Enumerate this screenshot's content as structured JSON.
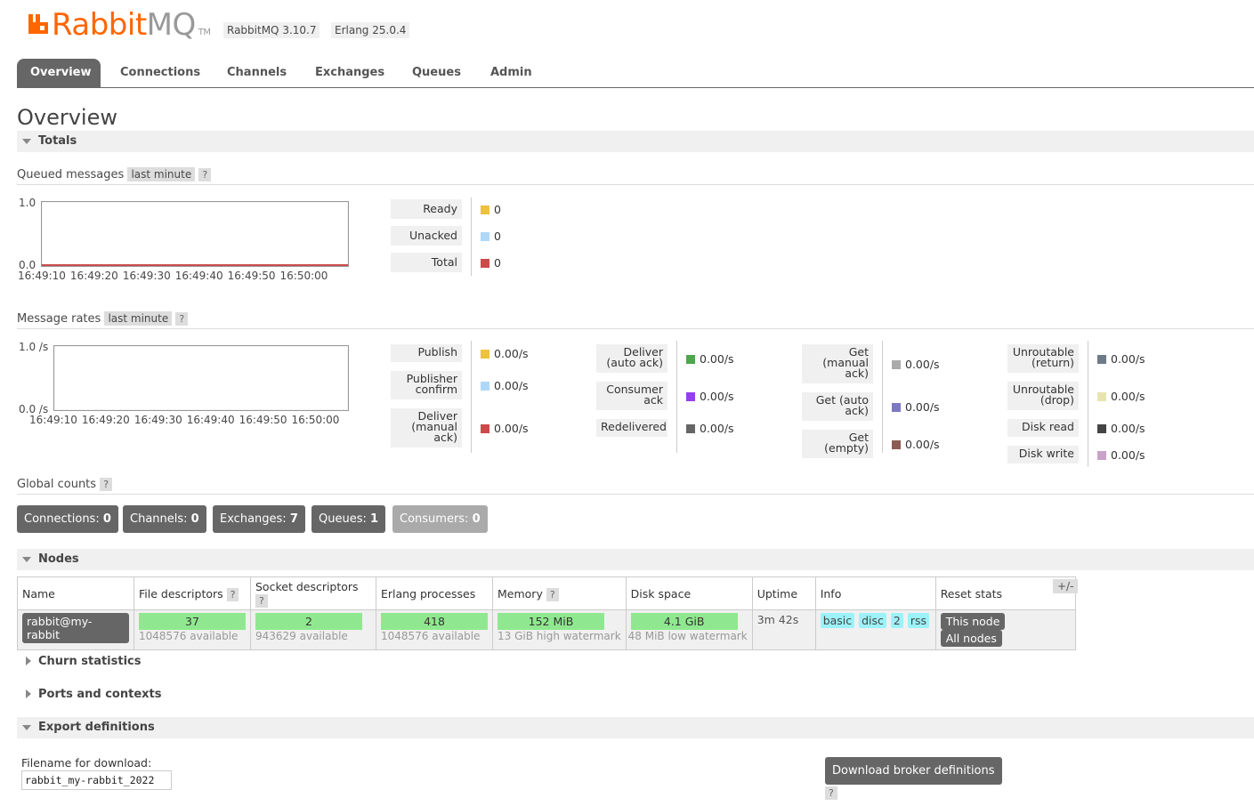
{
  "header": {
    "brand_rabbit": "Rabbit",
    "brand_mq": "MQ",
    "brand_tm": "TM",
    "rabbitmq_version": "RabbitMQ 3.10.7",
    "erlang_version": "Erlang 25.0.4"
  },
  "tabs": [
    {
      "label": "Overview",
      "active": true
    },
    {
      "label": "Connections"
    },
    {
      "label": "Channels"
    },
    {
      "label": "Exchanges"
    },
    {
      "label": "Queues"
    },
    {
      "label": "Admin"
    }
  ],
  "page_title": "Overview",
  "totals": {
    "section_title": "Totals",
    "queued": {
      "label": "Queued messages",
      "range": "last minute",
      "help": "?",
      "y_top": "1.0",
      "y_bottom": "0.0",
      "x_ticks": [
        "16:49:10",
        "16:49:20",
        "16:49:30",
        "16:49:40",
        "16:49:50",
        "16:50:00"
      ],
      "legend": [
        {
          "label": "Ready",
          "value": "0",
          "color": "#edc240"
        },
        {
          "label": "Unacked",
          "value": "0",
          "color": "#afd8f8"
        },
        {
          "label": "Total",
          "value": "0",
          "color": "#cb4b4b"
        }
      ]
    },
    "rates": {
      "label": "Message rates",
      "range": "last minute",
      "help": "?",
      "y_top": "1.0 /s",
      "y_bottom": "0.0 /s",
      "x_ticks": [
        "16:49:10",
        "16:49:20",
        "16:49:30",
        "16:49:40",
        "16:49:50",
        "16:50:00"
      ],
      "col1": [
        {
          "l1": "Publish",
          "l2": "",
          "l3": "",
          "value": "0.00/s",
          "color": "#edc240"
        },
        {
          "l1": "Publisher",
          "l2": "confirm",
          "l3": "",
          "value": "0.00/s",
          "color": "#afd8f8"
        },
        {
          "l1": "Deliver",
          "l2": "(manual",
          "l3": "ack)",
          "value": "0.00/s",
          "color": "#cb4b4b"
        }
      ],
      "col2": [
        {
          "l1": "Deliver",
          "l2": "(auto ack)",
          "l3": "",
          "value": "0.00/s",
          "color": "#4da74d"
        },
        {
          "l1": "Consumer",
          "l2": "ack",
          "l3": "",
          "value": "0.00/s",
          "color": "#9440ed"
        },
        {
          "l1": "Redelivered",
          "l2": "",
          "l3": "",
          "value": "0.00/s",
          "color": "#666666"
        }
      ],
      "col3": [
        {
          "l1": "Get",
          "l2": "(manual",
          "l3": "ack)",
          "value": "0.00/s",
          "color": "#aaaaaa"
        },
        {
          "l1": "Get (auto",
          "l2": "ack)",
          "l3": "",
          "value": "0.00/s",
          "color": "#7c79c3"
        },
        {
          "l1": "Get",
          "l2": "(empty)",
          "l3": "",
          "value": "0.00/s",
          "color": "#8d5b55"
        }
      ],
      "col4": [
        {
          "l1": "Unroutable",
          "l2": "(return)",
          "l3": "",
          "value": "0.00/s",
          "color": "#6d7a87"
        },
        {
          "l1": "Unroutable",
          "l2": "(drop)",
          "l3": "",
          "value": "0.00/s",
          "color": "#e8e4b0"
        },
        {
          "l1": "Disk read",
          "l2": "",
          "l3": "",
          "value": "0.00/s",
          "color": "#444444"
        },
        {
          "l1": "Disk write",
          "l2": "",
          "l3": "",
          "value": "0.00/s",
          "color": "#c8a2c8"
        }
      ]
    },
    "global": {
      "label": "Global counts",
      "help": "?",
      "connections_label": "Connections:",
      "connections": "0",
      "channels_label": "Channels:",
      "channels": "0",
      "exchanges_label": "Exchanges:",
      "exchanges": "7",
      "queues_label": "Queues:",
      "queues": "1",
      "consumers_label": "Consumers:",
      "consumers": "0"
    }
  },
  "nodes": {
    "section_title": "Nodes",
    "plus_minus": "+/-",
    "columns": {
      "name": "Name",
      "fd": "File descriptors",
      "fd_help": "?",
      "sd": "Socket descriptors",
      "sd_help": "?",
      "erl": "Erlang processes",
      "mem": "Memory",
      "mem_help": "?",
      "disk": "Disk space",
      "uptime": "Uptime",
      "info": "Info",
      "reset": "Reset stats"
    },
    "row": {
      "name": "rabbit@my-rabbit",
      "fd": "37",
      "fd_avail": "1048576 available",
      "sd": "2",
      "sd_avail": "943629 available",
      "erl": "418",
      "erl_avail": "1048576 available",
      "mem": "152 MiB",
      "mem_wm": "13 GiB high watermark",
      "disk": "4.1 GiB",
      "disk_wm": "48 MiB low watermark",
      "uptime": "3m 42s",
      "info_tags": [
        "basic",
        "disc",
        "2",
        "rss"
      ],
      "reset_this": "This node",
      "reset_all": "All nodes"
    }
  },
  "churn": {
    "section_title": "Churn statistics"
  },
  "ports": {
    "section_title": "Ports and contexts"
  },
  "export": {
    "section_title": "Export definitions",
    "filename_label": "Filename for download:",
    "filename_value": "rabbit_my-rabbit_2022",
    "download_label": "Download broker definitions",
    "help": "?"
  }
}
